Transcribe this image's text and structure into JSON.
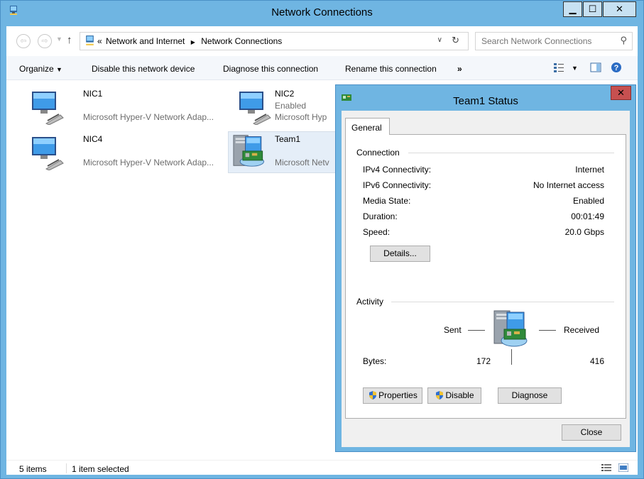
{
  "window": {
    "title": "Network Connections"
  },
  "address": {
    "crumb_overflow": "«",
    "crumbs": [
      "Network and Internet",
      "Network Connections"
    ],
    "separator": "▶"
  },
  "search": {
    "placeholder": "Search Network Connections"
  },
  "toolbar": {
    "organize": "Organize",
    "disable": "Disable this network device",
    "diagnose": "Diagnose this connection",
    "rename": "Rename this connection",
    "more": "»"
  },
  "items": [
    {
      "name": "NIC1",
      "status": "",
      "desc": "Microsoft Hyper-V Network Adap..."
    },
    {
      "name": "NIC2",
      "status": "Enabled",
      "desc": "Microsoft Hyp"
    },
    {
      "name": "NIC4",
      "status": "",
      "desc": "Microsoft Hyper-V Network Adap..."
    },
    {
      "name": "Team1",
      "status": "",
      "desc": "Microsoft Netv"
    }
  ],
  "statusbar": {
    "count": "5 items",
    "selected": "1 item selected"
  },
  "dialog": {
    "title": "Team1 Status",
    "tab": "General",
    "connection_label": "Connection",
    "rows": [
      {
        "k": "IPv4 Connectivity:",
        "v": "Internet"
      },
      {
        "k": "IPv6 Connectivity:",
        "v": "No Internet access"
      },
      {
        "k": "Media State:",
        "v": "Enabled"
      },
      {
        "k": "Duration:",
        "v": "00:01:49"
      },
      {
        "k": "Speed:",
        "v": "20.0 Gbps"
      }
    ],
    "details_button": "Details...",
    "activity_label": "Activity",
    "sent_label": "Sent",
    "received_label": "Received",
    "bytes_label": "Bytes:",
    "bytes_sent": "172",
    "bytes_received": "416",
    "properties_button": "Properties",
    "disable_button": "Disable",
    "diagnose_button": "Diagnose",
    "close_button": "Close"
  },
  "icons": {
    "app": "network-connections-icon",
    "nic": "network-adapter-icon",
    "team": "team-adapter-icon",
    "shield": "uac-shield-icon"
  },
  "colors": {
    "title_bar": "#6fb5e2",
    "close_red": "#c75050",
    "selection": "#e5eef8"
  }
}
